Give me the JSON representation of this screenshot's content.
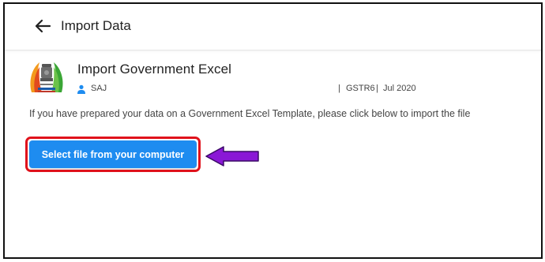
{
  "header": {
    "title": "Import Data",
    "back_icon": "arrow-left-icon"
  },
  "card": {
    "title": "Import Government Excel",
    "user_icon": "person-icon",
    "user_name": "SAJ",
    "separator": "|",
    "return_type": "GSTR6",
    "period": "Jul 2020",
    "description": "If you have prepared your data on a Government Excel Template, please click below to import the file"
  },
  "action": {
    "button_label": "Select file from your computer"
  },
  "annotation": {
    "arrow_color": "#8a18d6",
    "highlight_color": "#e0121b"
  },
  "colors": {
    "button_bg": "#1e8cf0",
    "icon_blue": "#1e8cf0"
  }
}
